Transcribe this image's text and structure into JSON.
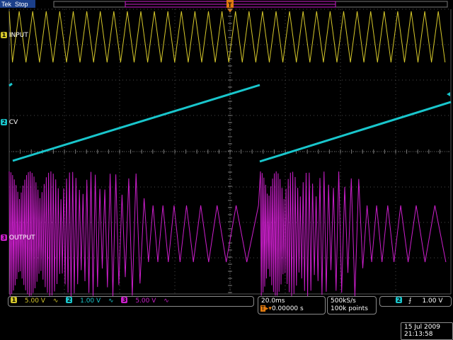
{
  "header": {
    "brand": "Tek",
    "run_state": "Stop",
    "trigger_marker": "T"
  },
  "channels": {
    "ch1": {
      "number": "1",
      "label": "INPUT",
      "color": "#d4c62a",
      "scale": "5.00 V"
    },
    "ch2": {
      "number": "2",
      "label": "CV",
      "color": "#19c6cc",
      "scale": "1.00 V"
    },
    "ch3": {
      "number": "3",
      "label": "OUTPUT",
      "color": "#cc1fcc",
      "scale": "5.00 V"
    }
  },
  "coupling_symbol": "∿",
  "timebase": {
    "scale": "20.0ms",
    "trigger_position": "0.00000 s"
  },
  "acquisition": {
    "sample_rate": "500kS/s",
    "record_length": "100k points"
  },
  "trigger": {
    "source": "2",
    "slope_symbol": "⨍",
    "level": "1.00 V"
  },
  "datetime": {
    "date": "15 Jul 2009",
    "time": "21:13:58"
  }
}
